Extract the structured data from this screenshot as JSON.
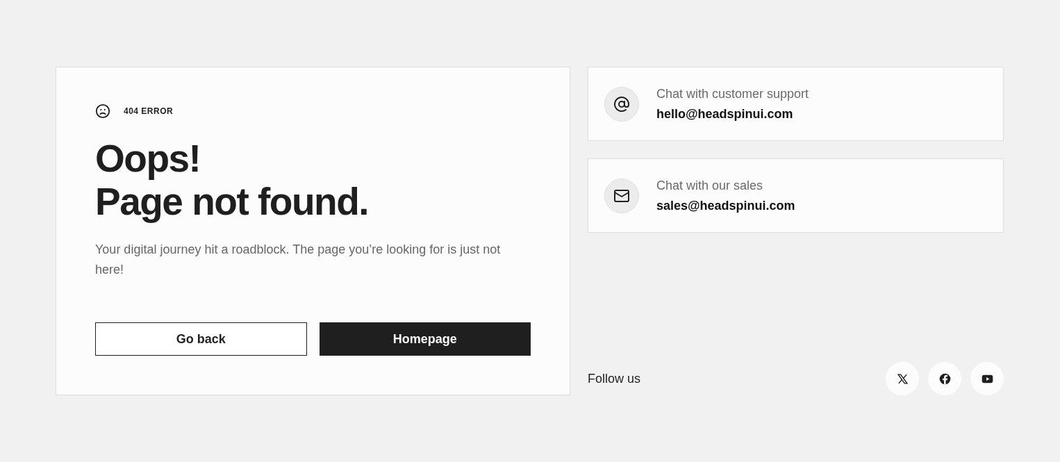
{
  "error_label": "404 ERROR",
  "heading_lines": [
    "Oops!",
    "Page not found."
  ],
  "description": "Your digital journey hit a roadblock. The page you’re looking for is just not here!",
  "buttons": [
    {
      "label": "Go back",
      "kind": "outline"
    },
    {
      "label": "Homepage",
      "kind": "primary"
    }
  ],
  "contacts": [
    {
      "kind": "at",
      "title": "Chat with customer support",
      "email": "hello@headspinui.com"
    },
    {
      "kind": "mail",
      "title": "Chat with our sales",
      "email": "sales@headspinui.com"
    }
  ],
  "follow_label": "Follow us",
  "socials": [
    {
      "kind": "x"
    },
    {
      "kind": "facebook"
    },
    {
      "kind": "youtube"
    }
  ]
}
